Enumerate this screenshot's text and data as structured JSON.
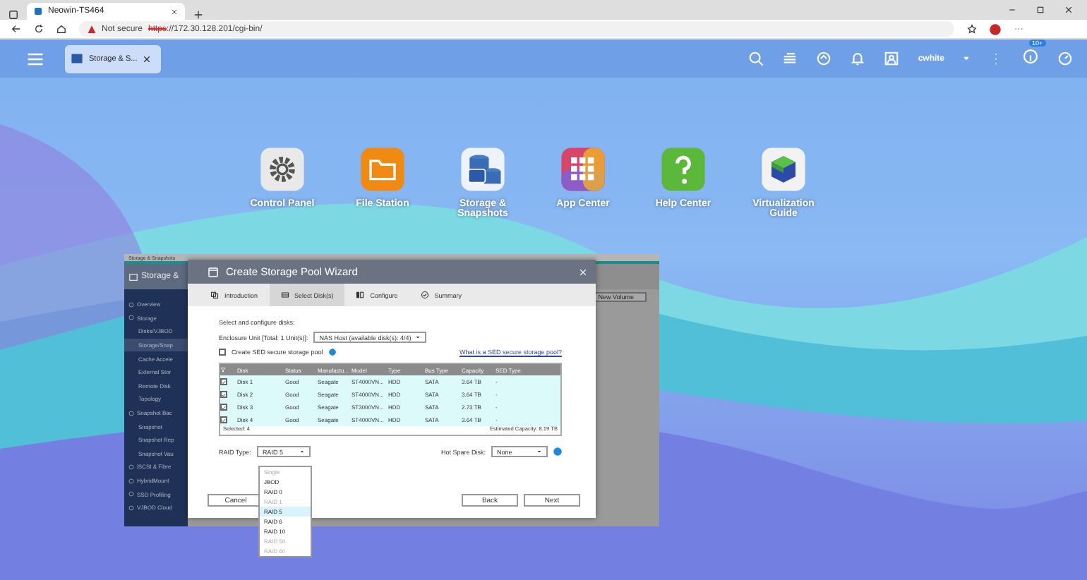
{
  "browser": {
    "tab_title": "Neowin-TS464",
    "security": "Not secure",
    "url_scheme": "https",
    "url_rest": "://172.30.128.201/cgi-bin/"
  },
  "topbar": {
    "app_tab": "Storage & S...",
    "user": "cwhite",
    "badge": "10+"
  },
  "desktop_apps": [
    {
      "label": "Control Panel",
      "kind": "gear"
    },
    {
      "label": "File Station",
      "kind": "folder"
    },
    {
      "label": "Storage & Snapshots",
      "kind": "storage"
    },
    {
      "label": "App Center",
      "kind": "grid"
    },
    {
      "label": "Help Center",
      "kind": "help"
    },
    {
      "label": "Virtualization Guide",
      "kind": "cube"
    }
  ],
  "back_window": {
    "title": "Storage & Snapshots",
    "header": "Storage &",
    "new_volume": "New Volume",
    "sidebar": [
      {
        "label": "Overview",
        "kind": "section",
        "selected": false
      },
      {
        "label": "Storage",
        "kind": "section",
        "selected": false
      },
      {
        "label": "Disks/VJBOD",
        "kind": "item",
        "selected": false
      },
      {
        "label": "Storage/Snap",
        "kind": "item",
        "selected": true
      },
      {
        "label": "Cache Accele",
        "kind": "item",
        "selected": false
      },
      {
        "label": "External Stor",
        "kind": "item",
        "selected": false
      },
      {
        "label": "Remote Disk",
        "kind": "item",
        "selected": false
      },
      {
        "label": "Topology",
        "kind": "item",
        "selected": false
      },
      {
        "label": "Snapshot Bac",
        "kind": "section",
        "selected": false
      },
      {
        "label": "Snapshot",
        "kind": "item",
        "selected": false
      },
      {
        "label": "Snapshot Rep",
        "kind": "item",
        "selected": false
      },
      {
        "label": "Snapshot Vau",
        "kind": "item",
        "selected": false
      },
      {
        "label": "iSCSI & Fibre",
        "kind": "section",
        "selected": false
      },
      {
        "label": "HybridMount",
        "kind": "section",
        "selected": false
      },
      {
        "label": "SSD Profiling",
        "kind": "section",
        "selected": false
      },
      {
        "label": "VJBOD Cloud",
        "kind": "section",
        "selected": false
      }
    ]
  },
  "wizard": {
    "title": "Create Storage Pool Wizard",
    "steps": [
      {
        "label": "Introduction",
        "selected": false
      },
      {
        "label": "Select Disk(s)",
        "selected": true
      },
      {
        "label": "Configure",
        "selected": false
      },
      {
        "label": "Summary",
        "selected": false
      }
    ],
    "intro": "Select and configure disks:",
    "enclosure_label": "Enclosure Unit [Total: 1 Unit(s)]:",
    "enclosure_value": "NAS Host (available disk(s): 4/4)",
    "sed_checkbox": {
      "label": "Create SED secure storage pool",
      "checked": false
    },
    "sed_link": "What is a SED secure storage pool?",
    "table": {
      "columns": [
        "Disk",
        "Status",
        "Manufactu...",
        "Model",
        "Type",
        "Bus Type",
        "Capacity",
        "SED Type"
      ],
      "rows": [
        {
          "checked": true,
          "cells": [
            "Disk 1",
            "Good",
            "Seagate",
            "ST4000VN...",
            "HDD",
            "SATA",
            "3.64 TB",
            "-"
          ]
        },
        {
          "checked": true,
          "cells": [
            "Disk 2",
            "Good",
            "Seagate",
            "ST4000VN...",
            "HDD",
            "SATA",
            "3.64 TB",
            "-"
          ]
        },
        {
          "checked": true,
          "cells": [
            "Disk 3",
            "Good",
            "Seagate",
            "ST3000VN...",
            "HDD",
            "SATA",
            "2.73 TB",
            "-"
          ]
        },
        {
          "checked": true,
          "cells": [
            "Disk 4",
            "Good",
            "Seagate",
            "ST4000VN...",
            "HDD",
            "SATA",
            "3.64 TB",
            "-"
          ]
        }
      ],
      "selected": "Selected: 4",
      "estimate": "Estimated Capacity: 8.19 TB"
    },
    "raid_label": "RAID Type:",
    "raid_value": "RAID 5",
    "raid_options": [
      {
        "label": "Single",
        "selected": false,
        "disabled": true
      },
      {
        "label": "JBOD",
        "selected": false,
        "disabled": false
      },
      {
        "label": "RAID 0",
        "selected": false,
        "disabled": false
      },
      {
        "label": "RAID 1",
        "selected": false,
        "disabled": true
      },
      {
        "label": "RAID 5",
        "selected": true,
        "disabled": false
      },
      {
        "label": "RAID 6",
        "selected": false,
        "disabled": false
      },
      {
        "label": "RAID 10",
        "selected": false,
        "disabled": false
      },
      {
        "label": "RAID 50",
        "selected": false,
        "disabled": true
      },
      {
        "label": "RAID 60",
        "selected": false,
        "disabled": true
      }
    ],
    "hot_spare_label": "Hot Spare Disk:",
    "hot_spare_value": "None",
    "buttons": {
      "cancel": "Cancel",
      "back": "Back",
      "next": "Next"
    }
  }
}
